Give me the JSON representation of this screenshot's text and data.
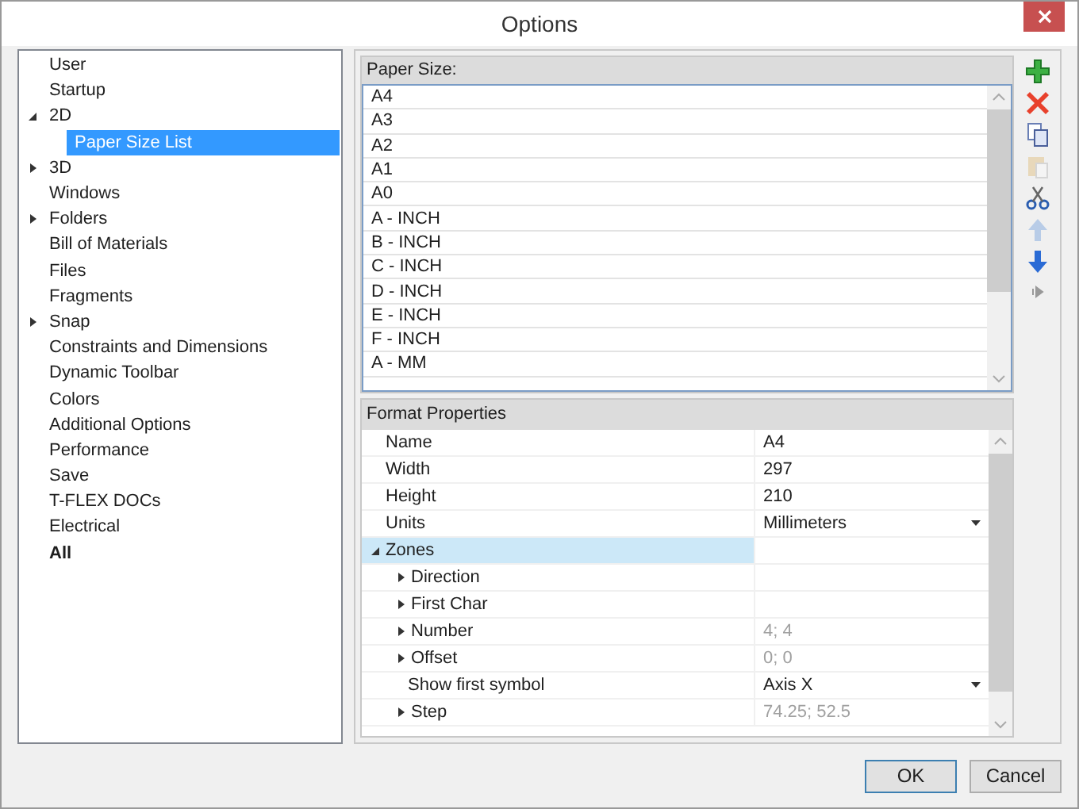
{
  "window": {
    "title": "Options"
  },
  "tree": [
    {
      "label": "User",
      "selected": false,
      "bold": false
    },
    {
      "label": "Startup",
      "selected": false,
      "bold": false
    },
    {
      "label": "2D",
      "selected": false,
      "bold": false,
      "expanded": true,
      "children": [
        {
          "label": "Paper Size List",
          "selected": true,
          "bold": false
        }
      ]
    },
    {
      "label": "3D",
      "selected": false,
      "bold": false,
      "expanded": false
    },
    {
      "label": "Windows",
      "selected": false,
      "bold": false
    },
    {
      "label": "Folders",
      "selected": false,
      "bold": false,
      "expanded": false
    },
    {
      "label": "Bill of Materials",
      "selected": false,
      "bold": false
    },
    {
      "label": "Files",
      "selected": false,
      "bold": false
    },
    {
      "label": "Fragments",
      "selected": false,
      "bold": false
    },
    {
      "label": "Snap",
      "selected": false,
      "bold": false,
      "expanded": false
    },
    {
      "label": "Constraints and Dimensions",
      "selected": false,
      "bold": false
    },
    {
      "label": "Dynamic Toolbar",
      "selected": false,
      "bold": false
    },
    {
      "label": "Colors",
      "selected": false,
      "bold": false
    },
    {
      "label": "Additional Options",
      "selected": false,
      "bold": false
    },
    {
      "label": "Performance",
      "selected": false,
      "bold": false
    },
    {
      "label": "Save",
      "selected": false,
      "bold": false
    },
    {
      "label": "T-FLEX DOCs",
      "selected": false,
      "bold": false
    },
    {
      "label": "Electrical",
      "selected": false,
      "bold": false
    },
    {
      "label": "All",
      "selected": false,
      "bold": true
    }
  ],
  "paper_sizes": {
    "title": "Paper Size:",
    "items": [
      "A4",
      "A3",
      "A2",
      "A1",
      "A0",
      "A - INCH",
      "B - INCH",
      "C - INCH",
      "D - INCH",
      "E - INCH",
      "F - INCH",
      "A - MM"
    ]
  },
  "toolbar": [
    {
      "kind": "add",
      "disabled": false
    },
    {
      "kind": "delete",
      "disabled": false
    },
    {
      "kind": "copy",
      "disabled": false
    },
    {
      "kind": "paste",
      "disabled": true
    },
    {
      "kind": "cut",
      "disabled": false
    },
    {
      "kind": "up",
      "disabled": true
    },
    {
      "kind": "down",
      "disabled": false
    },
    {
      "kind": "more",
      "disabled": false
    }
  ],
  "properties": {
    "title": "Format Properties",
    "rows": [
      {
        "label": "Name",
        "value": "A4",
        "kind": "text",
        "disabled": false,
        "selected": false
      },
      {
        "label": "Width",
        "value": "297",
        "kind": "text",
        "disabled": false,
        "selected": false
      },
      {
        "label": "Height",
        "value": "210",
        "kind": "text",
        "disabled": false,
        "selected": false
      },
      {
        "label": "Units",
        "value": "Millimeters",
        "kind": "dropdown",
        "disabled": false,
        "selected": false
      },
      {
        "label": "Zones",
        "kind": "text",
        "selected": true,
        "expanded": true,
        "children": [
          {
            "label": "Direction",
            "kind": "text",
            "selected": false,
            "expanded": false
          },
          {
            "label": "First Char",
            "kind": "text",
            "selected": false,
            "expanded": false
          },
          {
            "label": "Number",
            "value": "4; 4",
            "kind": "text",
            "disabled": true,
            "selected": false,
            "expanded": false
          },
          {
            "label": "Offset",
            "value": "0; 0",
            "kind": "text",
            "disabled": true,
            "selected": false,
            "expanded": false
          },
          {
            "label": "Show first symbol",
            "value": "Axis X",
            "kind": "dropdown",
            "disabled": false,
            "selected": false
          },
          {
            "label": "Step",
            "value": "74.25; 52.5",
            "kind": "text",
            "disabled": true,
            "selected": false,
            "expanded": false
          }
        ]
      }
    ]
  },
  "buttons": [
    {
      "label": "OK",
      "selected": true
    },
    {
      "label": "Cancel",
      "selected": false
    }
  ]
}
